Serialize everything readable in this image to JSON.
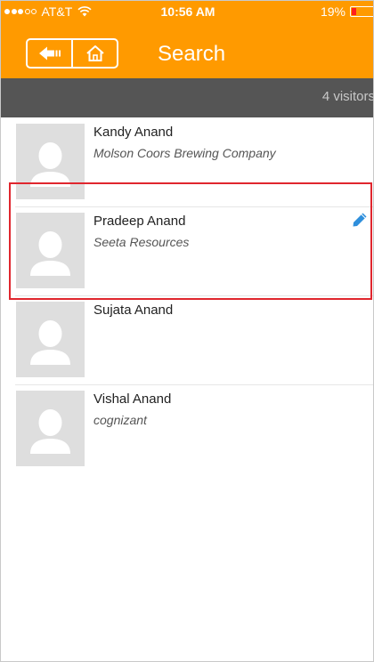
{
  "status_bar": {
    "carrier": "AT&T",
    "time": "10:56 AM",
    "battery_percent": "19%",
    "battery_level": 0.19,
    "battery_color": "#ff1e1e",
    "signal_dots": [
      true,
      true,
      true,
      false,
      false
    ],
    "wifi_icon": "wifi-icon"
  },
  "header": {
    "title": "Search",
    "background_color": "#ff9a00",
    "back_icon": "back-arrow-icon",
    "home_icon": "home-icon"
  },
  "summary": {
    "count_text": "4 visitors"
  },
  "visitors": [
    {
      "name": "Kandy Anand",
      "company": "Molson Coors Brewing Company",
      "editable": false
    },
    {
      "name": "Pradeep Anand",
      "company": "Seeta Resources",
      "editable": true
    },
    {
      "name": "Sujata Anand",
      "company": "",
      "editable": false
    },
    {
      "name": "Vishal Anand",
      "company": "cognizant",
      "editable": false
    }
  ],
  "colors": {
    "count_bar": "#555555",
    "highlight_border": "#e0262e",
    "edit_icon": "#2f8fdc",
    "avatar_bg": "#dedede"
  }
}
